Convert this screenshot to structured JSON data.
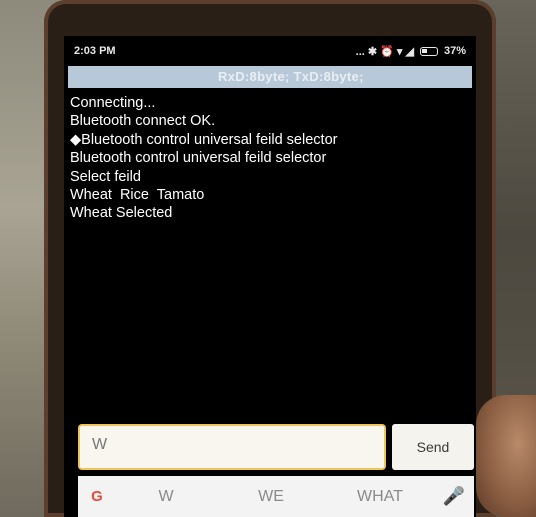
{
  "status_bar": {
    "time": "2:03 PM",
    "icons": "... ✱ ⏰ ▾ ◢",
    "battery": "37%"
  },
  "info_bar": {
    "text": "RxD:8byte; TxD:8byte;"
  },
  "terminal": {
    "lines": [
      "Connecting...",
      "Bluetooth connect OK.",
      "◆Bluetooth control universal feild selector",
      "Bluetooth control universal feild selector",
      "Select feild",
      "Wheat  Rice  Tamato",
      "Wheat Selected"
    ]
  },
  "input": {
    "value": "W",
    "send_label": "Send"
  },
  "suggestions": {
    "items": [
      "W",
      "WE",
      "WHAT"
    ]
  }
}
